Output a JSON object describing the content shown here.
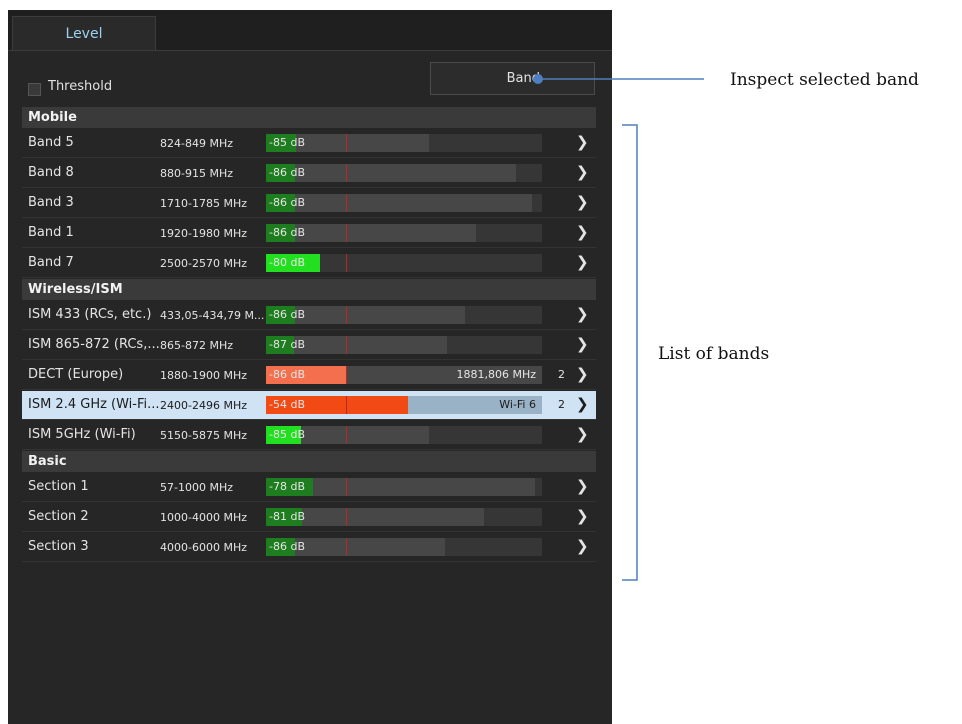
{
  "tabs": [
    {
      "label": "Level"
    }
  ],
  "threshold": {
    "label": "Threshold",
    "checked": false
  },
  "band_button": {
    "label": "Band"
  },
  "annotations": {
    "inspect": "Inspect selected band",
    "list": "List of bands"
  },
  "colors": {
    "green": "#1e7d1e",
    "bright_green": "#22e01f",
    "salmon": "#f36f4e",
    "light_salmon": "#f9a484",
    "orange_red": "#f24a14",
    "threshold_line": "#b42828",
    "selected_row": "#cfe3f5",
    "tab_text": "#9ed0f0",
    "callout_line": "#4f7fbf"
  },
  "groups": [
    {
      "title": "Mobile",
      "rows": [
        {
          "name": "Band 5",
          "freq": "824-849 MHz",
          "level": "-85 dB",
          "fill": 0.107,
          "extent": 0.59,
          "color": "#1e7d1e",
          "extra": "",
          "count": ""
        },
        {
          "name": "Band 8",
          "freq": "880-915 MHz",
          "level": "-86 dB",
          "fill": 0.105,
          "extent": 0.905,
          "color": "#1e7d1e",
          "extra": "",
          "count": ""
        },
        {
          "name": "Band 3",
          "freq": "1710-1785 MHz",
          "level": "-86 dB",
          "fill": 0.105,
          "extent": 0.965,
          "color": "#1e7d1e",
          "extra": "",
          "count": ""
        },
        {
          "name": "Band 1",
          "freq": "1920-1980 MHz",
          "level": "-86 dB",
          "fill": 0.105,
          "extent": 0.76,
          "color": "#1e7d1e",
          "extra": "",
          "count": ""
        },
        {
          "name": "Band 7",
          "freq": "2500-2570 MHz",
          "level": "-80 dB",
          "fill": 0.195,
          "extent": 0.195,
          "color": "#22e01f",
          "extra": "",
          "count": ""
        }
      ]
    },
    {
      "title": "Wireless/ISM",
      "rows": [
        {
          "name": "ISM 433 (RCs, etc.)",
          "freq": "433,05-434,79 M...",
          "level": "-86 dB",
          "fill": 0.105,
          "extent": 0.72,
          "color": "#1e7d1e",
          "extra": "",
          "count": ""
        },
        {
          "name": "ISM 865-872 (RCs,...",
          "freq": "865-872 MHz",
          "level": "-87 dB",
          "fill": 0.1,
          "extent": 0.655,
          "color": "#1e7d1e",
          "extra": "",
          "count": ""
        },
        {
          "name": "DECT (Europe)",
          "freq": "1880-1900 MHz",
          "level": "-86 dB",
          "fill": 0.29,
          "extent": 1.0,
          "color": "#f36f4e",
          "extra": "1881,806 MHz",
          "count": "2"
        },
        {
          "name": "ISM 2.4 GHz (Wi-Fi...",
          "freq": "2400-2496 MHz",
          "level": "-54 dB",
          "fill": 0.515,
          "extent": 1.0,
          "color": "#f24a14",
          "extra": "Wi-Fi 6",
          "count": "2",
          "selected": true
        },
        {
          "name": "ISM 5GHz (Wi-Fi)",
          "freq": "5150-5875 MHz",
          "level": "-85 dB",
          "fill": 0.125,
          "extent": 0.59,
          "color": "#22e01f",
          "extra": "",
          "count": ""
        }
      ]
    },
    {
      "title": "Basic",
      "rows": [
        {
          "name": "Section 1",
          "freq": "57-1000 MHz",
          "level": "-78 dB",
          "fill": 0.17,
          "extent": 0.975,
          "color": "#1e7d1e",
          "extra": "",
          "count": ""
        },
        {
          "name": "Section 2",
          "freq": "1000-4000 MHz",
          "level": "-81 dB",
          "fill": 0.13,
          "extent": 0.79,
          "color": "#1e7d1e",
          "extra": "",
          "count": ""
        },
        {
          "name": "Section 3",
          "freq": "4000-6000 MHz",
          "level": "-86 dB",
          "fill": 0.105,
          "extent": 0.65,
          "color": "#1e7d1e",
          "extra": "",
          "count": ""
        }
      ]
    }
  ]
}
